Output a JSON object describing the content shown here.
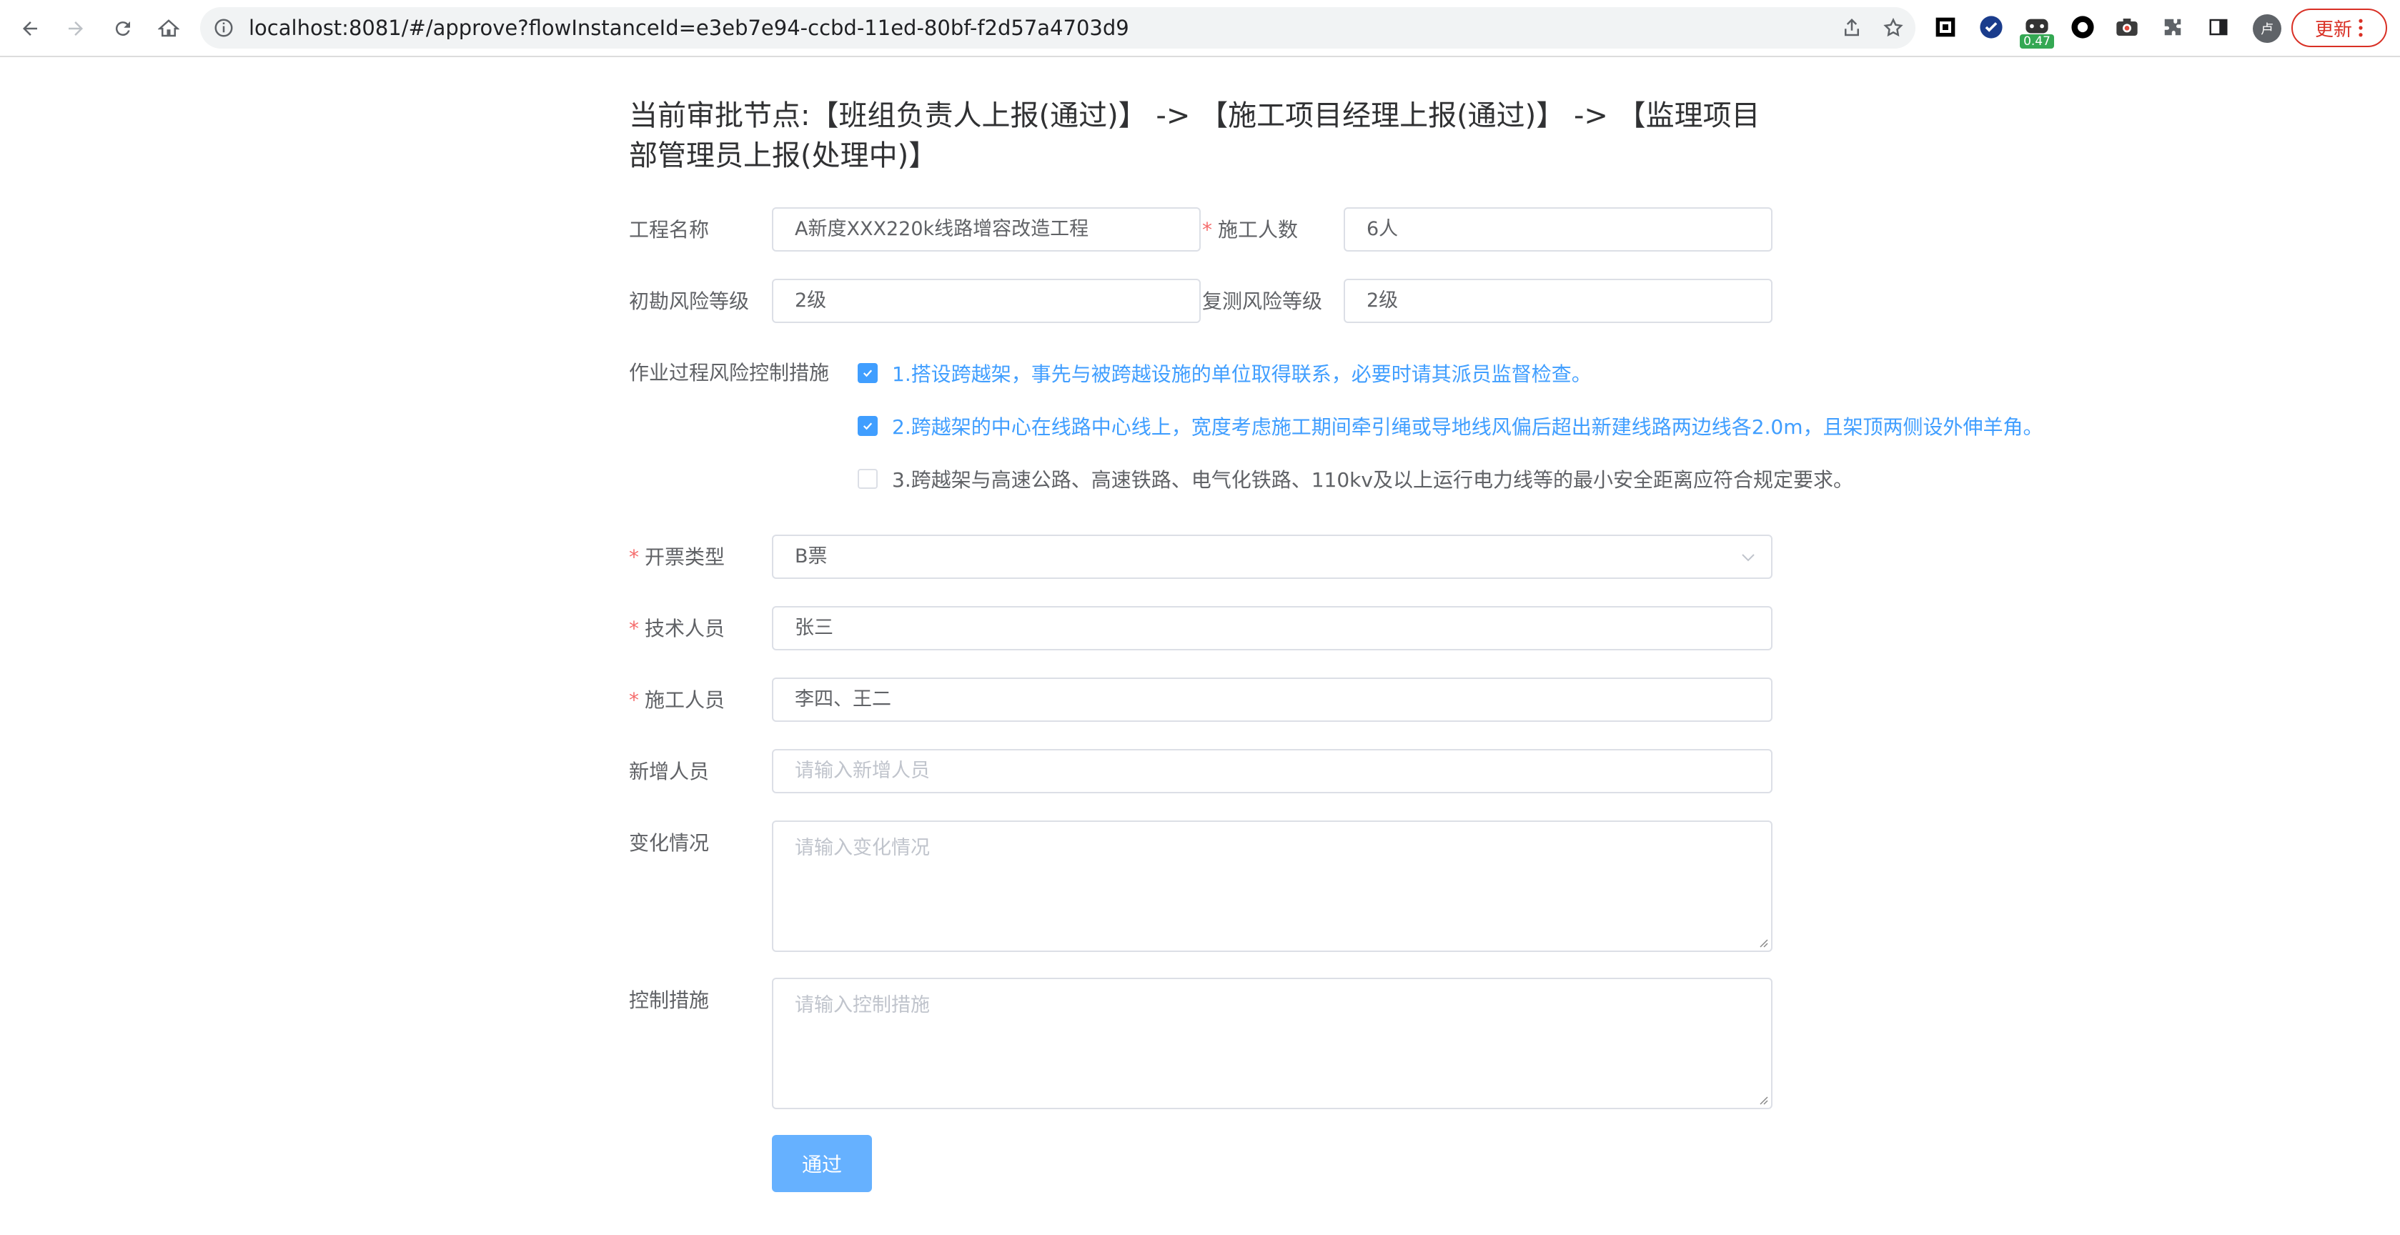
{
  "browser": {
    "url": "localhost:8081/#/approve?flowInstanceId=e3eb7e94-ccbd-11ed-80bf-f2d57a4703d9",
    "extension_badge": "0.47",
    "avatar_text": "卢",
    "update_label": "更新"
  },
  "form": {
    "node_title": "当前审批节点:【班组负责人上报(通过)】 -> 【施工项目经理上报(通过)】 -> 【监理项目部管理员上报(处理中)】",
    "project_name": {
      "label": "工程名称",
      "value": "A新度XXX220k线路增容改造工程"
    },
    "worker_count": {
      "label": "施工人数",
      "value": "6人",
      "required": true
    },
    "initial_risk": {
      "label": "初勘风险等级",
      "value": "2级"
    },
    "recheck_risk": {
      "label": "复测风险等级",
      "value": "2级"
    },
    "risk_measures": {
      "label": "作业过程风险控制措施",
      "items": [
        {
          "text": "1.搭设跨越架，事先与被跨越设施的单位取得联系，必要时请其派员监督检查。",
          "checked": true
        },
        {
          "text": "2.跨越架的中心在线路中心线上，宽度考虑施工期间牵引绳或导地线风偏后超出新建线路两边线各2.0m，且架顶两侧设外伸羊角。",
          "checked": true
        },
        {
          "text": "3.跨越架与高速公路、高速铁路、电气化铁路、110kv及以上运行电力线等的最小安全距离应符合规定要求。",
          "checked": false
        }
      ]
    },
    "ticket_type": {
      "label": "开票类型",
      "value": "B票",
      "required": true
    },
    "technician": {
      "label": "技术人员",
      "value": "张三",
      "required": true
    },
    "workers": {
      "label": "施工人员",
      "value": "李四、王二",
      "required": true
    },
    "new_staff": {
      "label": "新增人员",
      "placeholder": "请输入新增人员"
    },
    "changes": {
      "label": "变化情况",
      "placeholder": "请输入变化情况"
    },
    "controls": {
      "label": "控制措施",
      "placeholder": "请输入控制措施"
    },
    "submit_label": "通过"
  },
  "colors": {
    "primary": "#409eff",
    "button": "#66b1ff",
    "required": "#f56c6c",
    "browser_update": "#d93025"
  }
}
